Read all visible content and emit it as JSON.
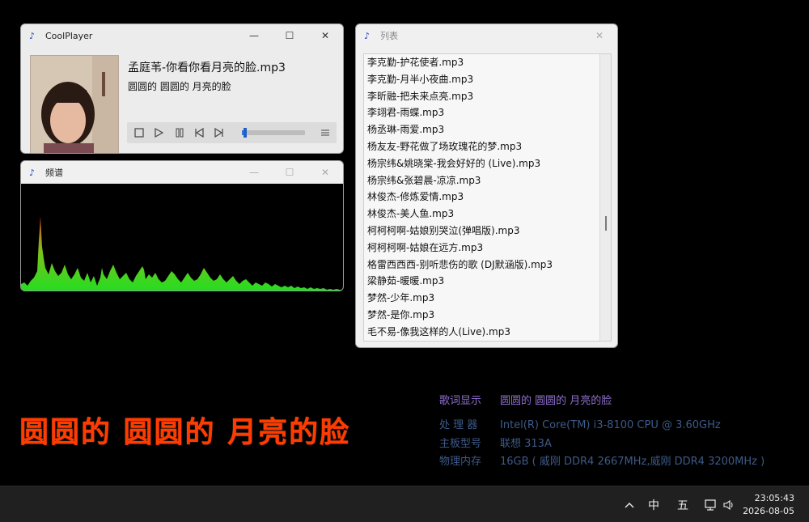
{
  "player": {
    "title": "CoolPlayer",
    "song": "孟庭苇-你看你看月亮的脸.mp3",
    "lyric": "圆圆的 圆圆的 月亮的脸",
    "progress": 0.05,
    "minimize": "—",
    "maximize": "☐",
    "close": "✕"
  },
  "spectrum": {
    "title": "频谱",
    "accent": "#22dd22",
    "peak": "#e0401a"
  },
  "playlist": {
    "title": "列表",
    "items": [
      "李克勤-护花使者.mp3",
      "李克勤-月半小夜曲.mp3",
      "李昕融-把未来点亮.mp3",
      "李翊君-雨蝶.mp3",
      "杨丞琳-雨爱.mp3",
      "杨友友-野花做了场玫瑰花的梦.mp3",
      "杨宗纬&姚晓棠-我会好好的 (Live).mp3",
      "杨宗纬&张碧晨-凉凉.mp3",
      "林俊杰-修炼爱情.mp3",
      "林俊杰-美人鱼.mp3",
      "柯柯柯啊-姑娘别哭泣(弹唱版).mp3",
      "柯柯柯啊-姑娘在远方.mp3",
      "格雷西西西-别听悲伤的歌 (DJ默涵版).mp3",
      "梁静茹-暖暖.mp3",
      "梦然-少年.mp3",
      "梦然-是你.mp3",
      "毛不易-像我这样的人(Live).mp3"
    ]
  },
  "big_lyric": "圆圆的  圆圆的  月亮的脸",
  "info": {
    "lyric_label": "歌词显示",
    "lyric_value": "圆圆的 圆圆的 月亮的脸",
    "cpu_label": "处 理 器",
    "cpu_value": "Intel(R) Core(TM) i3-8100 CPU @ 3.60GHz",
    "board_label": "主板型号",
    "board_value": "联想 313A",
    "mem_label": "物理内存",
    "mem_value": "16GB ( 威刚 DDR4 2667MHz,威刚 DDR4 3200MHz )"
  },
  "taskbar": {
    "ime_lang": "中",
    "ime_mode": "五",
    "time": "23:05:43",
    "date": "2026-08-05"
  }
}
